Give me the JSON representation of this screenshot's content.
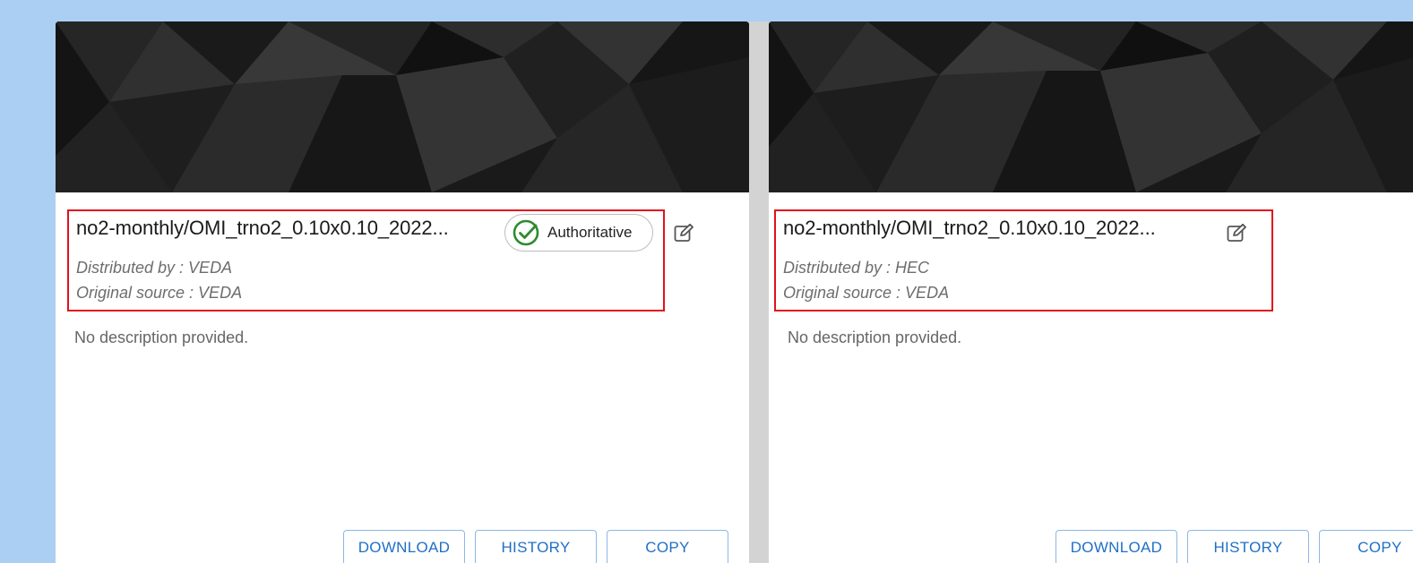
{
  "cards": [
    {
      "title": "no2-monthly/OMI_trno2_0.10x0.10_2022...",
      "badge": {
        "label": "Authoritative",
        "icon": "check-circle-icon",
        "color": "#2e8b2e"
      },
      "distributed_by": "Distributed by : VEDA",
      "original_source": "Original source : VEDA",
      "description": "No description provided.",
      "buttons": {
        "download": "DOWNLOAD",
        "history": "HISTORY",
        "copy": "COPY"
      }
    },
    {
      "title": "no2-monthly/OMI_trno2_0.10x0.10_2022...",
      "distributed_by": "Distributed by : HEC",
      "original_source": "Original source : VEDA",
      "description": "No description provided.",
      "buttons": {
        "download": "DOWNLOAD",
        "history": "HISTORY",
        "copy": "COPY"
      }
    }
  ],
  "colors": {
    "page_background": "#abcff2",
    "highlight_border": "#e0121d",
    "button_text": "#1f6fc7",
    "button_border": "#8cb8e6"
  }
}
